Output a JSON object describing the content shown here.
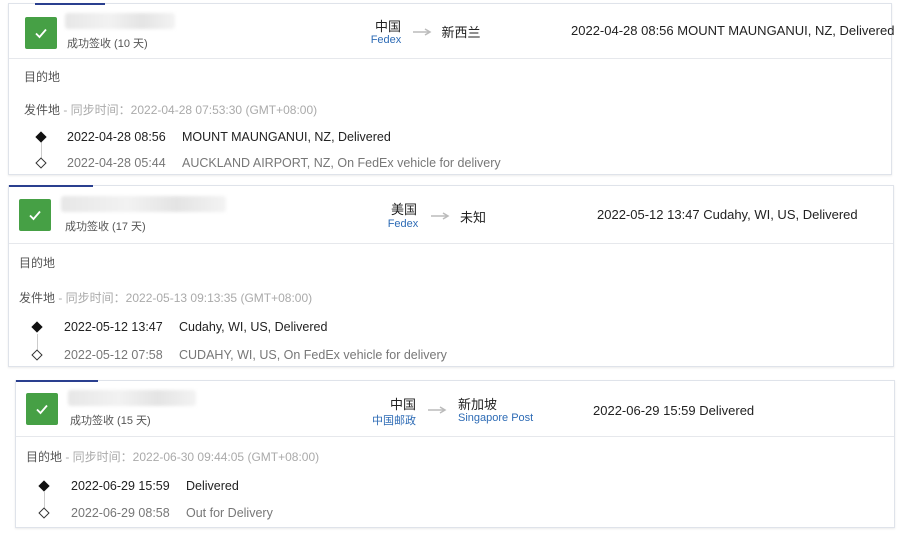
{
  "shipments": [
    {
      "status": "成功签收 (10 天)",
      "origin": "中国",
      "origin_carrier": "Fedex",
      "destination": "新西兰",
      "destination_carrier": "",
      "latest": "2022-04-28 08:56  MOUNT MAUNGANUI, NZ, Delivered",
      "dest_label": "目的地",
      "origin_label": "发件地",
      "sync_text": " - 同步时间：2022-04-28 07:53:30 (GMT+08:00)",
      "events": [
        {
          "time": "2022-04-28 08:56",
          "desc": "MOUNT MAUNGANUI, NZ, Delivered"
        },
        {
          "time": "2022-04-28 05:44",
          "desc": "AUCKLAND AIRPORT, NZ, On FedEx vehicle for delivery"
        }
      ]
    },
    {
      "status": "成功签收 (17 天)",
      "origin": "美国",
      "origin_carrier": "Fedex",
      "destination": "未知",
      "destination_carrier": "",
      "latest": "2022-05-12 13:47  Cudahy, WI, US, Delivered",
      "dest_label": "目的地",
      "origin_label": "发件地",
      "sync_text": " - 同步时间：2022-05-13 09:13:35 (GMT+08:00)",
      "events": [
        {
          "time": "2022-05-12 13:47",
          "desc": "Cudahy, WI, US, Delivered"
        },
        {
          "time": "2022-05-12 07:58",
          "desc": "CUDAHY, WI, US, On FedEx vehicle for delivery"
        }
      ]
    },
    {
      "status": "成功签收 (15 天)",
      "origin": "中国",
      "origin_carrier": "中国邮政",
      "destination": "新加坡",
      "destination_carrier": "Singapore Post",
      "latest": "2022-06-29 15:59  Delivered",
      "dest_label": "目的地",
      "origin_label": "",
      "sync_text": " - 同步时间：2022-06-30 09:44:05 (GMT+08:00)",
      "events": [
        {
          "time": "2022-06-29 15:59",
          "desc": "Delivered"
        },
        {
          "time": "2022-06-29 08:58",
          "desc": "Out for Delivery"
        }
      ]
    }
  ],
  "colors": {
    "success": "#46a045",
    "carrier_link": "#2d6bb5",
    "accent": "#2a3f8f"
  },
  "icons": {
    "status": "checkmark-icon",
    "route": "arrow-right-icon",
    "event_latest": "filled-diamond-icon",
    "event_past": "hollow-diamond-icon"
  }
}
